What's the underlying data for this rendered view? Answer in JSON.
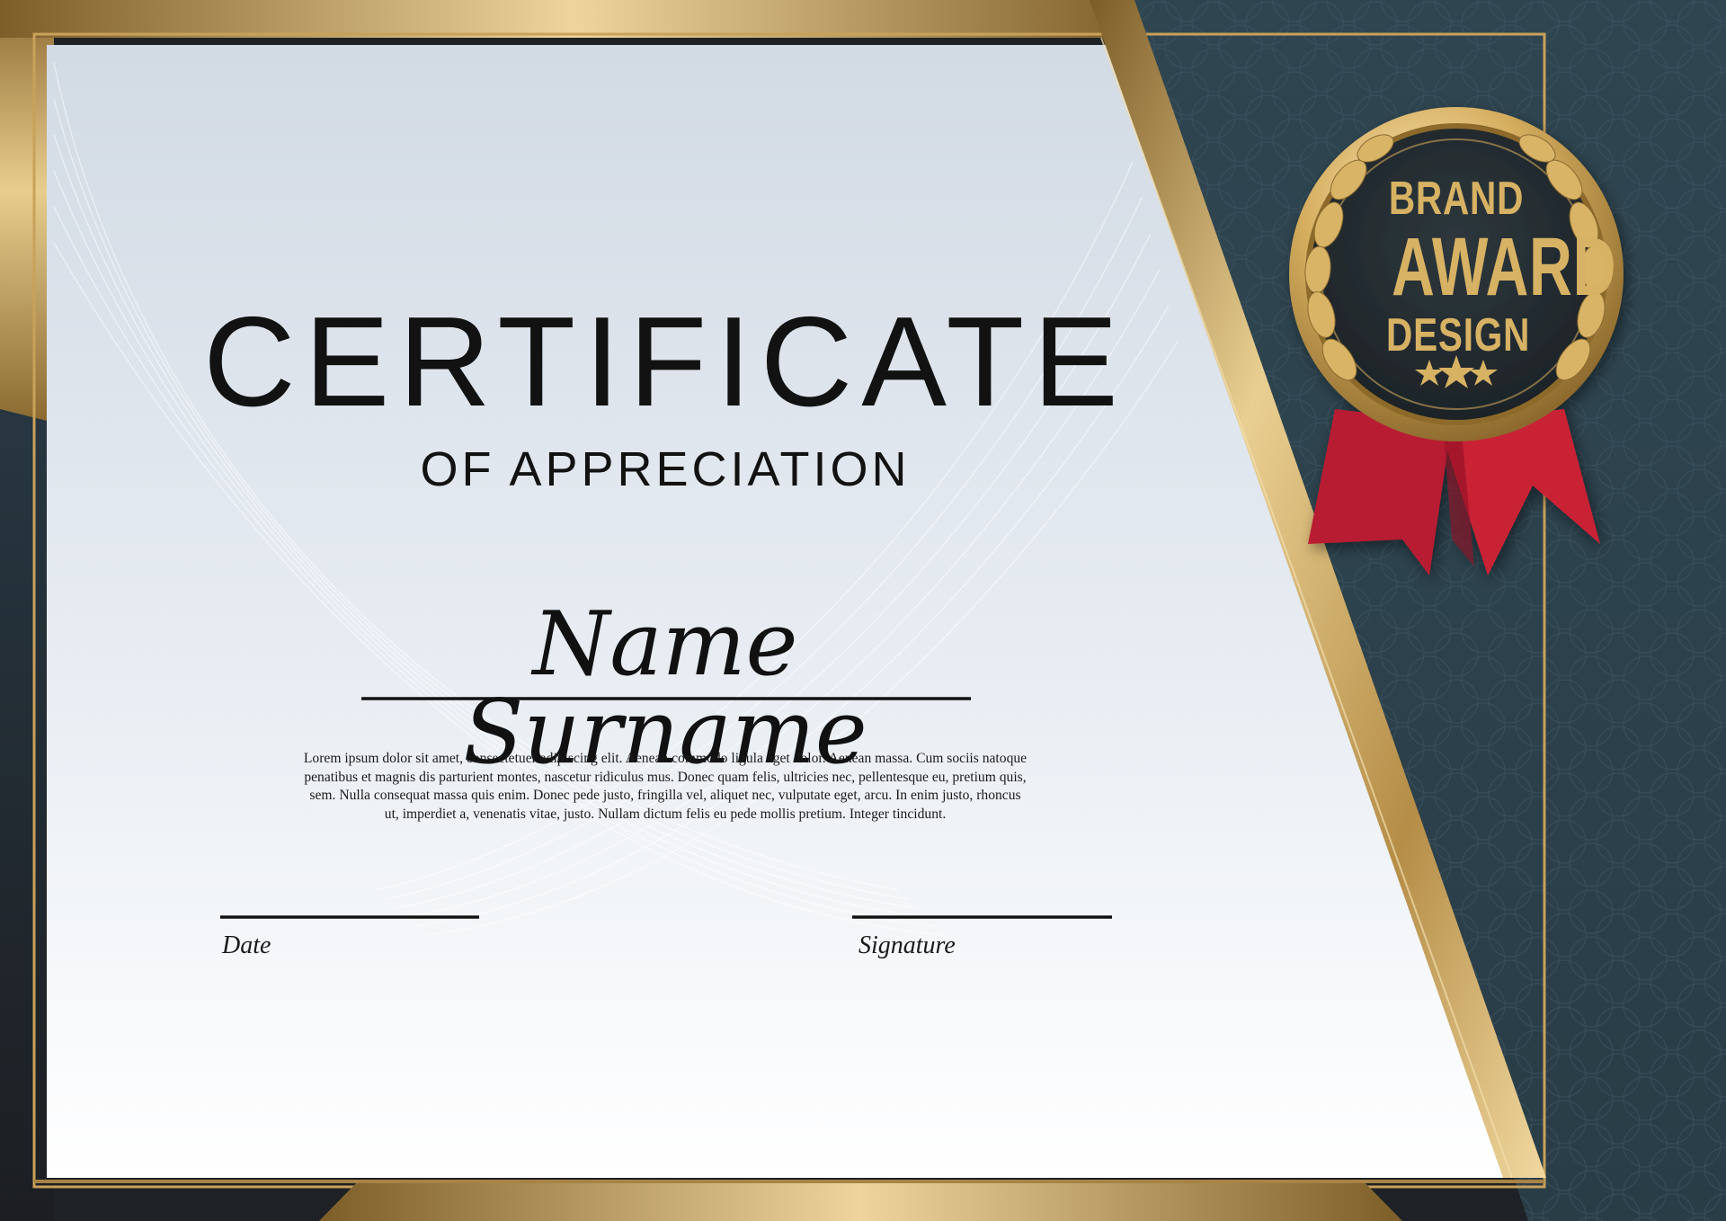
{
  "certificate": {
    "title": "CERTIFICATE",
    "subtitle": "OF APPRECIATION",
    "recipient_name": "Name Surname",
    "body_text": "Lorem ipsum dolor sit amet, consectetuer adipiscing elit. Aenean commodo ligula eget dolor. Aenean massa. Cum sociis natoque penatibus et magnis dis parturient montes, nascetur ridiculus mus. Donec quam felis, ultricies nec, pellentesque eu, pretium quis, sem. Nulla consequat massa quis enim. Donec pede justo, fringilla vel, aliquet nec, vulputate eget, arcu. In enim justo, rhoncus ut, imperdiet a, venenatis vitae, justo. Nullam dictum felis eu pede mollis pretium. Integer tincidunt.",
    "date_label": "Date",
    "signature_label": "Signature"
  },
  "badge": {
    "line1": "BRAND",
    "line2": "AWARD",
    "line3": "DESIGN",
    "stars": 3,
    "icon": "award-seal-icon"
  },
  "colors": {
    "gold": "#c9a15a",
    "gold_light": "#f1d9a0",
    "gold_dark": "#8a6a30",
    "teal": "#2f4651",
    "paper": "#e6ebf1",
    "ribbon": "#c21f32",
    "badge_center": "#222a2e"
  }
}
